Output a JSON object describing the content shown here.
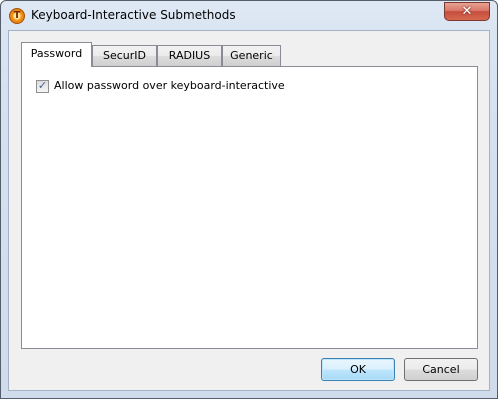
{
  "window": {
    "title": "Keyboard-Interactive Submethods",
    "icon": "app-logo-icon",
    "icon_letter": "T",
    "close_label": "✕"
  },
  "tabs": [
    {
      "label": "Password",
      "active": true
    },
    {
      "label": "SecurID",
      "active": false
    },
    {
      "label": "RADIUS",
      "active": false
    },
    {
      "label": "Generic",
      "active": false
    }
  ],
  "password_panel": {
    "allow_password_checkbox": {
      "label": "Allow password over keyboard-interactive",
      "checked": true,
      "check_glyph": "✓"
    }
  },
  "buttons": {
    "ok_label": "OK",
    "cancel_label": "Cancel"
  },
  "colors": {
    "title_bar": "#dae5f2",
    "close_button": "#c44e3d",
    "default_button": "#bee6fd",
    "dialog_body": "#f0f0f0"
  }
}
